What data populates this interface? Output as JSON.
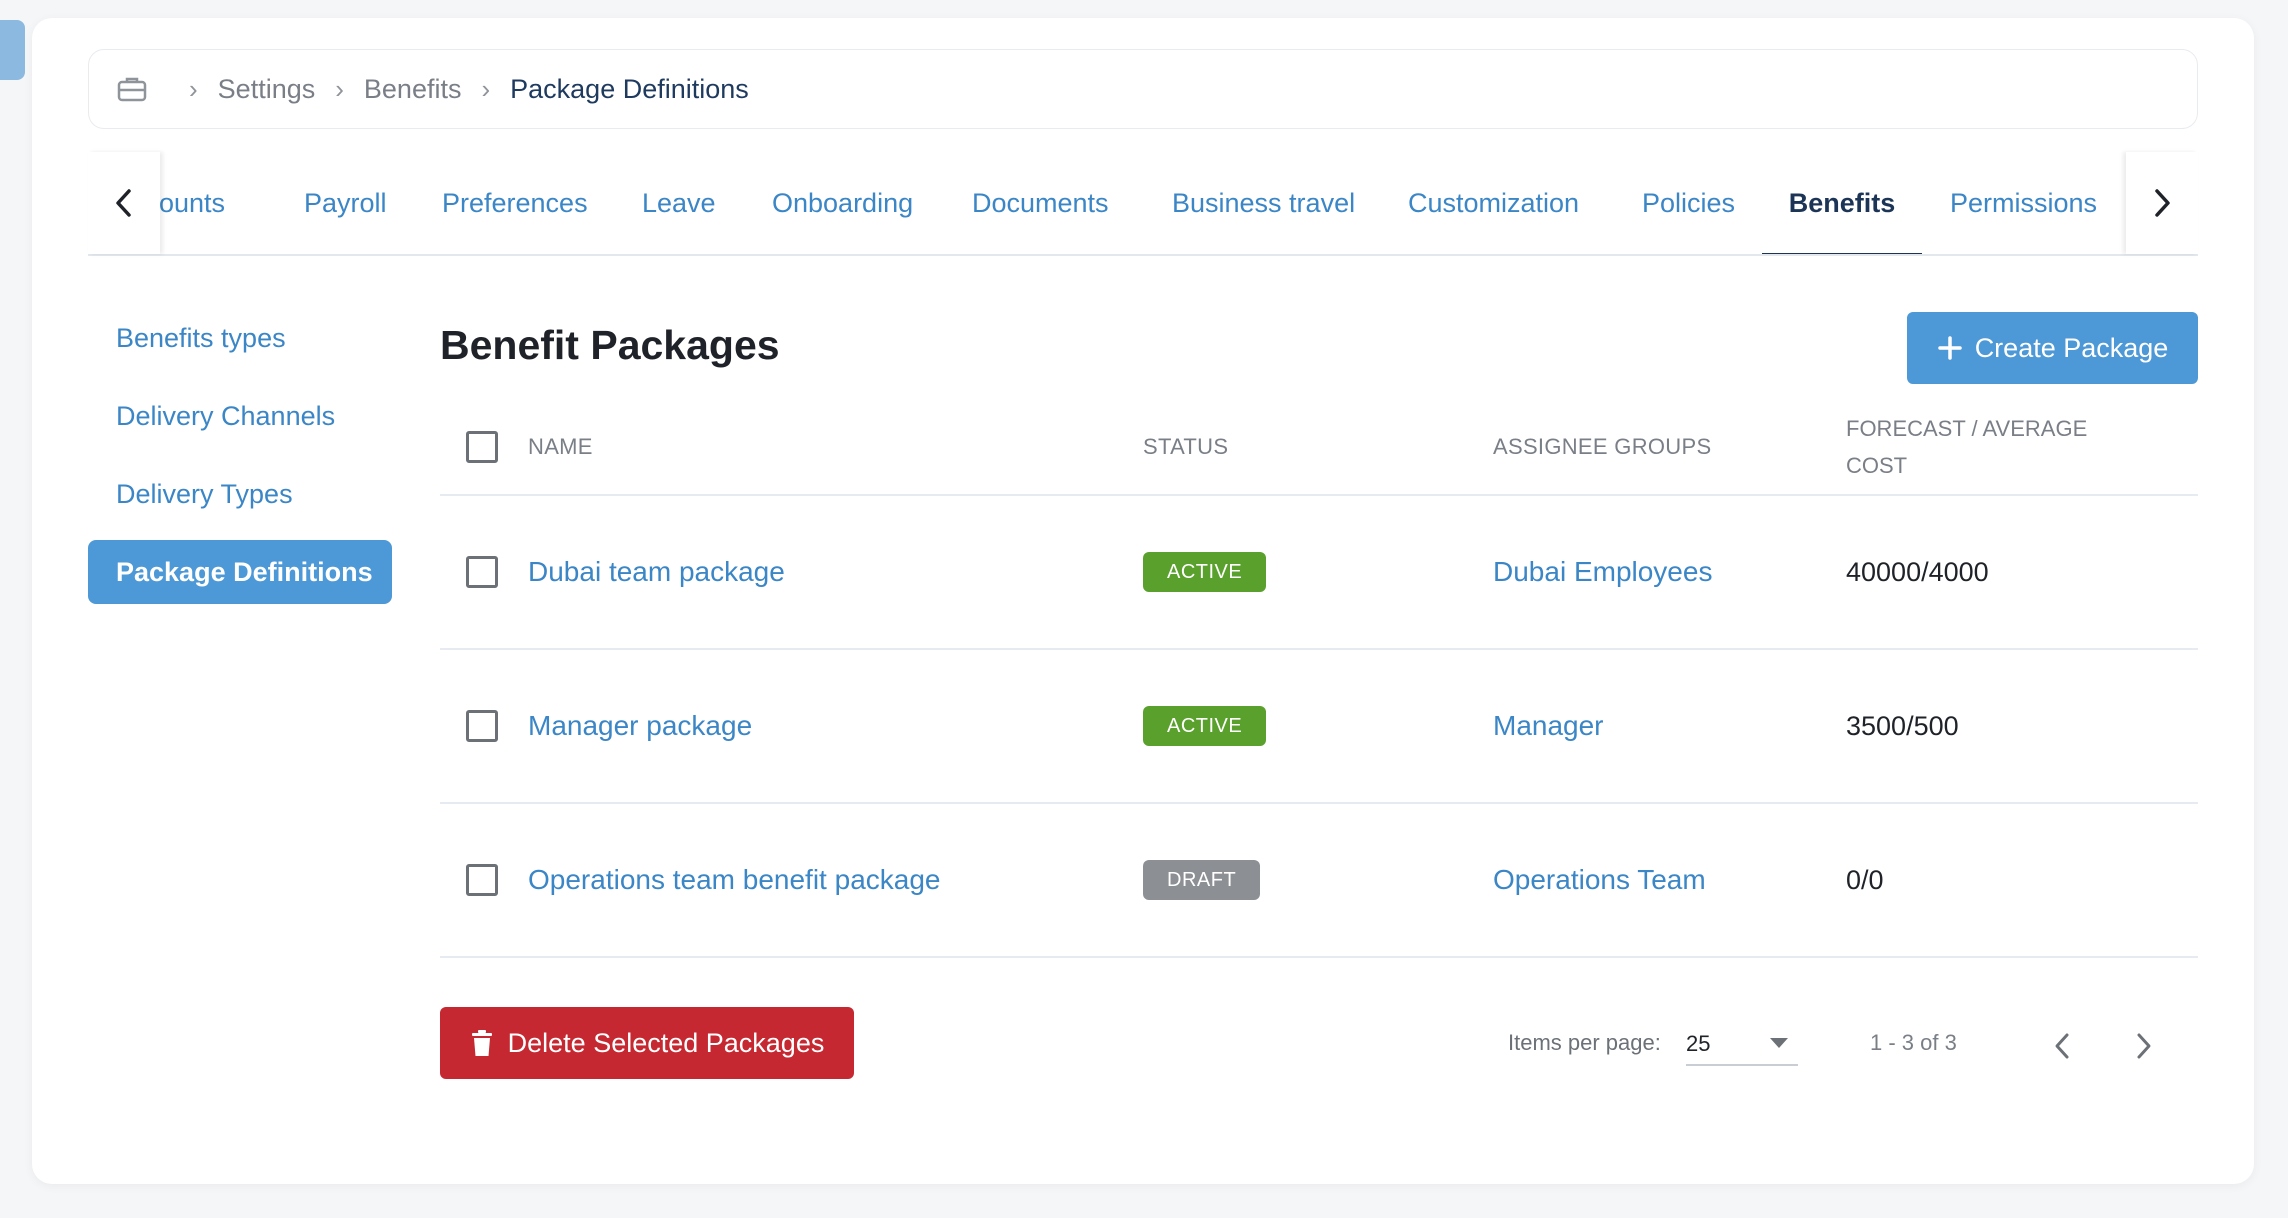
{
  "breadcrumb": {
    "icon": "briefcase-icon",
    "items": [
      "Settings",
      "Benefits"
    ],
    "current": "Package Definitions"
  },
  "tabs": {
    "items": [
      "Accounts",
      "Payroll",
      "Preferences",
      "Leave",
      "Onboarding",
      "Documents",
      "Business travel",
      "Customization",
      "Policies",
      "Benefits",
      "Permissions"
    ],
    "active": "Benefits"
  },
  "left_menu": {
    "items": [
      "Benefits types",
      "Delivery Channels",
      "Delivery Types",
      "Package Definitions"
    ],
    "active": "Package Definitions"
  },
  "page": {
    "title": "Benefit Packages",
    "create_button": "Create Package",
    "delete_button": "Delete Selected Packages"
  },
  "table": {
    "headers": {
      "name": "NAME",
      "status": "STATUS",
      "groups": "ASSIGNEE GROUPS",
      "cost_line1": "FORECAST / AVERAGE",
      "cost_line2": "COST"
    },
    "rows": [
      {
        "name": "Dubai team package",
        "status": "ACTIVE",
        "group": "Dubai Employees",
        "cost": "40000/4000"
      },
      {
        "name": "Manager package",
        "status": "ACTIVE",
        "group": "Manager",
        "cost": "3500/500"
      },
      {
        "name": "Operations team benefit package",
        "status": "DRAFT",
        "group": "Operations Team",
        "cost": "0/0"
      }
    ]
  },
  "pagination": {
    "items_per_page_label": "Items per page:",
    "items_per_page_value": "25",
    "range": "1 - 3 of 3"
  },
  "colors": {
    "accent": "#4d98d6",
    "link": "#3b86c6",
    "active_badge": "#5aa02c",
    "draft_badge": "#8c8f93",
    "danger": "#c62831",
    "nav_active": "#1c3557"
  }
}
